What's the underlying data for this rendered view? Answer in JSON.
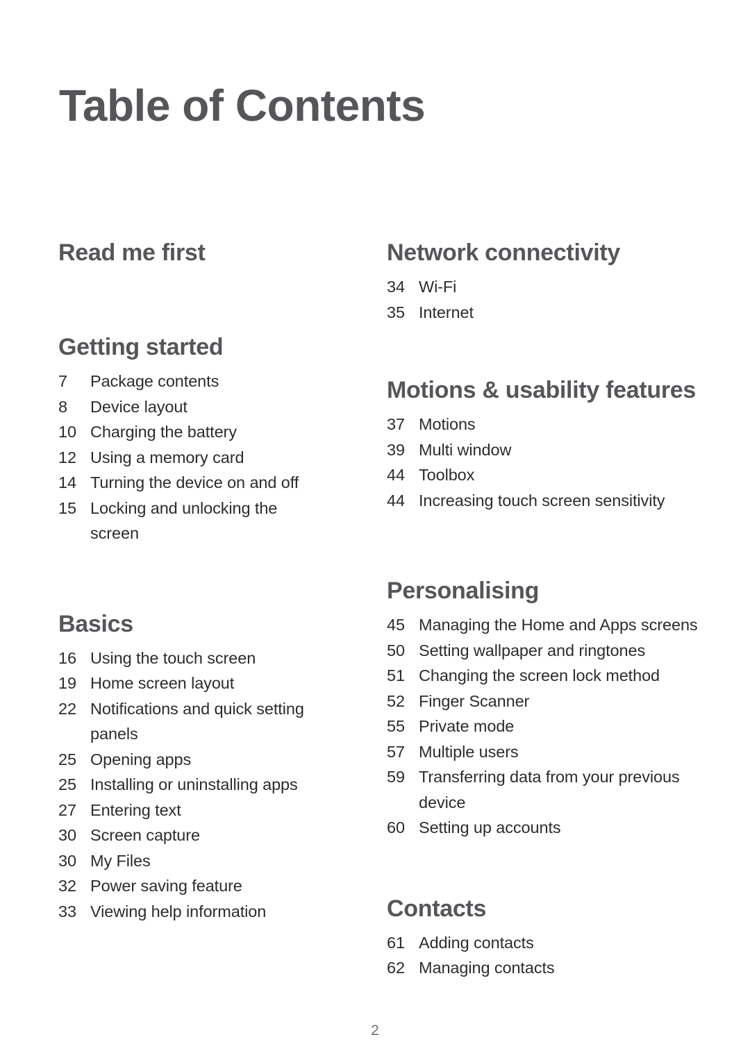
{
  "document": {
    "title": "Table of Contents",
    "page_number": "2",
    "colors": {
      "heading": "#56565a",
      "entry_text": "#2c2c2c",
      "page_number": "#6b7073",
      "background": "#ffffff"
    }
  },
  "columns": {
    "left": [
      {
        "heading": "Read me first",
        "entries": []
      },
      {
        "heading": "Getting started",
        "entries": [
          {
            "page": "7",
            "title": "Package contents"
          },
          {
            "page": "8",
            "title": "Device layout"
          },
          {
            "page": "10",
            "title": "Charging the battery"
          },
          {
            "page": "12",
            "title": "Using a memory card"
          },
          {
            "page": "14",
            "title": "Turning the device on and off"
          },
          {
            "page": "15",
            "title": "Locking and unlocking the screen"
          }
        ]
      },
      {
        "heading": "Basics",
        "entries": [
          {
            "page": "16",
            "title": "Using the touch screen"
          },
          {
            "page": "19",
            "title": "Home screen layout"
          },
          {
            "page": "22",
            "title": "Notifications and quick setting panels"
          },
          {
            "page": "25",
            "title": "Opening apps"
          },
          {
            "page": "25",
            "title": "Installing or uninstalling apps"
          },
          {
            "page": "27",
            "title": "Entering text"
          },
          {
            "page": "30",
            "title": "Screen capture"
          },
          {
            "page": "30",
            "title": "My Files"
          },
          {
            "page": "32",
            "title": "Power saving feature"
          },
          {
            "page": "33",
            "title": "Viewing help information"
          }
        ]
      }
    ],
    "right": [
      {
        "heading": "Network connectivity",
        "entries": [
          {
            "page": "34",
            "title": "Wi-Fi"
          },
          {
            "page": "35",
            "title": "Internet"
          }
        ]
      },
      {
        "heading": "Motions & usability features",
        "entries": [
          {
            "page": "37",
            "title": "Motions"
          },
          {
            "page": "39",
            "title": "Multi window"
          },
          {
            "page": "44",
            "title": "Toolbox"
          },
          {
            "page": "44",
            "title": "Increasing touch screen sensitivity"
          }
        ]
      },
      {
        "heading": "Personalising",
        "entries": [
          {
            "page": "45",
            "title": "Managing the Home and Apps screens"
          },
          {
            "page": "50",
            "title": "Setting wallpaper and ringtones"
          },
          {
            "page": "51",
            "title": "Changing the screen lock method"
          },
          {
            "page": "52",
            "title": "Finger Scanner"
          },
          {
            "page": "55",
            "title": "Private mode"
          },
          {
            "page": "57",
            "title": "Multiple users"
          },
          {
            "page": "59",
            "title": "Transferring data from your previous device"
          },
          {
            "page": "60",
            "title": "Setting up accounts"
          }
        ]
      },
      {
        "heading": "Contacts",
        "entries": [
          {
            "page": "61",
            "title": "Adding contacts"
          },
          {
            "page": "62",
            "title": "Managing contacts"
          }
        ]
      }
    ]
  }
}
